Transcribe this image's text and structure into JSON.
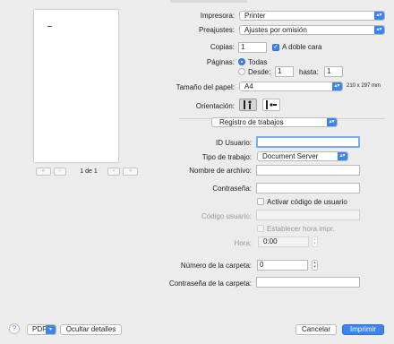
{
  "preview": {
    "page_label": "1 de 1"
  },
  "general": {
    "printer_label": "Impresora:",
    "printer_value": "Printer",
    "presets_label": "Preajustes:",
    "presets_value": "Ajustes por omisión",
    "copies_label": "Copias:",
    "copies_value": "1",
    "duplex_label": "A doble cara",
    "pages_label": "Páginas:",
    "pages_all": "Todas",
    "pages_from": "Desde:",
    "pages_from_value": "1",
    "pages_to": "hasta:",
    "pages_to_value": "1",
    "paper_label": "Tamaño del papel:",
    "paper_value": "A4",
    "paper_dims": "210 x 297 mm",
    "orientation_label": "Orientación:"
  },
  "section": {
    "value": "Registro de trabajos"
  },
  "job_log": {
    "user_id_label": "ID Usuario:",
    "user_id_value": "",
    "job_type_label": "Tipo de trabajo:",
    "job_type_value": "Document Server",
    "file_name_label": "Nombre de archivo:",
    "file_name_value": "",
    "password_label": "Contraseña:",
    "password_value": "",
    "user_code_check": "Activar código de usuario",
    "user_code_label": "Código usuario:",
    "user_code_value": "",
    "set_time_check": "Establecer hora impr.",
    "time_label": "Hora:",
    "time_value": "0:00",
    "folder_number_label": "Número de la carpeta:",
    "folder_number_value": "0",
    "folder_password_label": "Contraseña de la carpeta:",
    "folder_password_value": ""
  },
  "footer": {
    "help": "?",
    "pdf": "PDF",
    "hide_details": "Ocultar detalles",
    "cancel": "Cancelar",
    "print": "Imprimir"
  },
  "icons": {
    "help": "help-icon",
    "dropdown": "dropdown-arrows-icon",
    "checkmark": "checkmark-icon",
    "portrait": "portrait-orientation-icon",
    "landscape": "landscape-orientation-icon"
  },
  "colors": {
    "accent": "#3b84f1",
    "background": "#ececec"
  }
}
